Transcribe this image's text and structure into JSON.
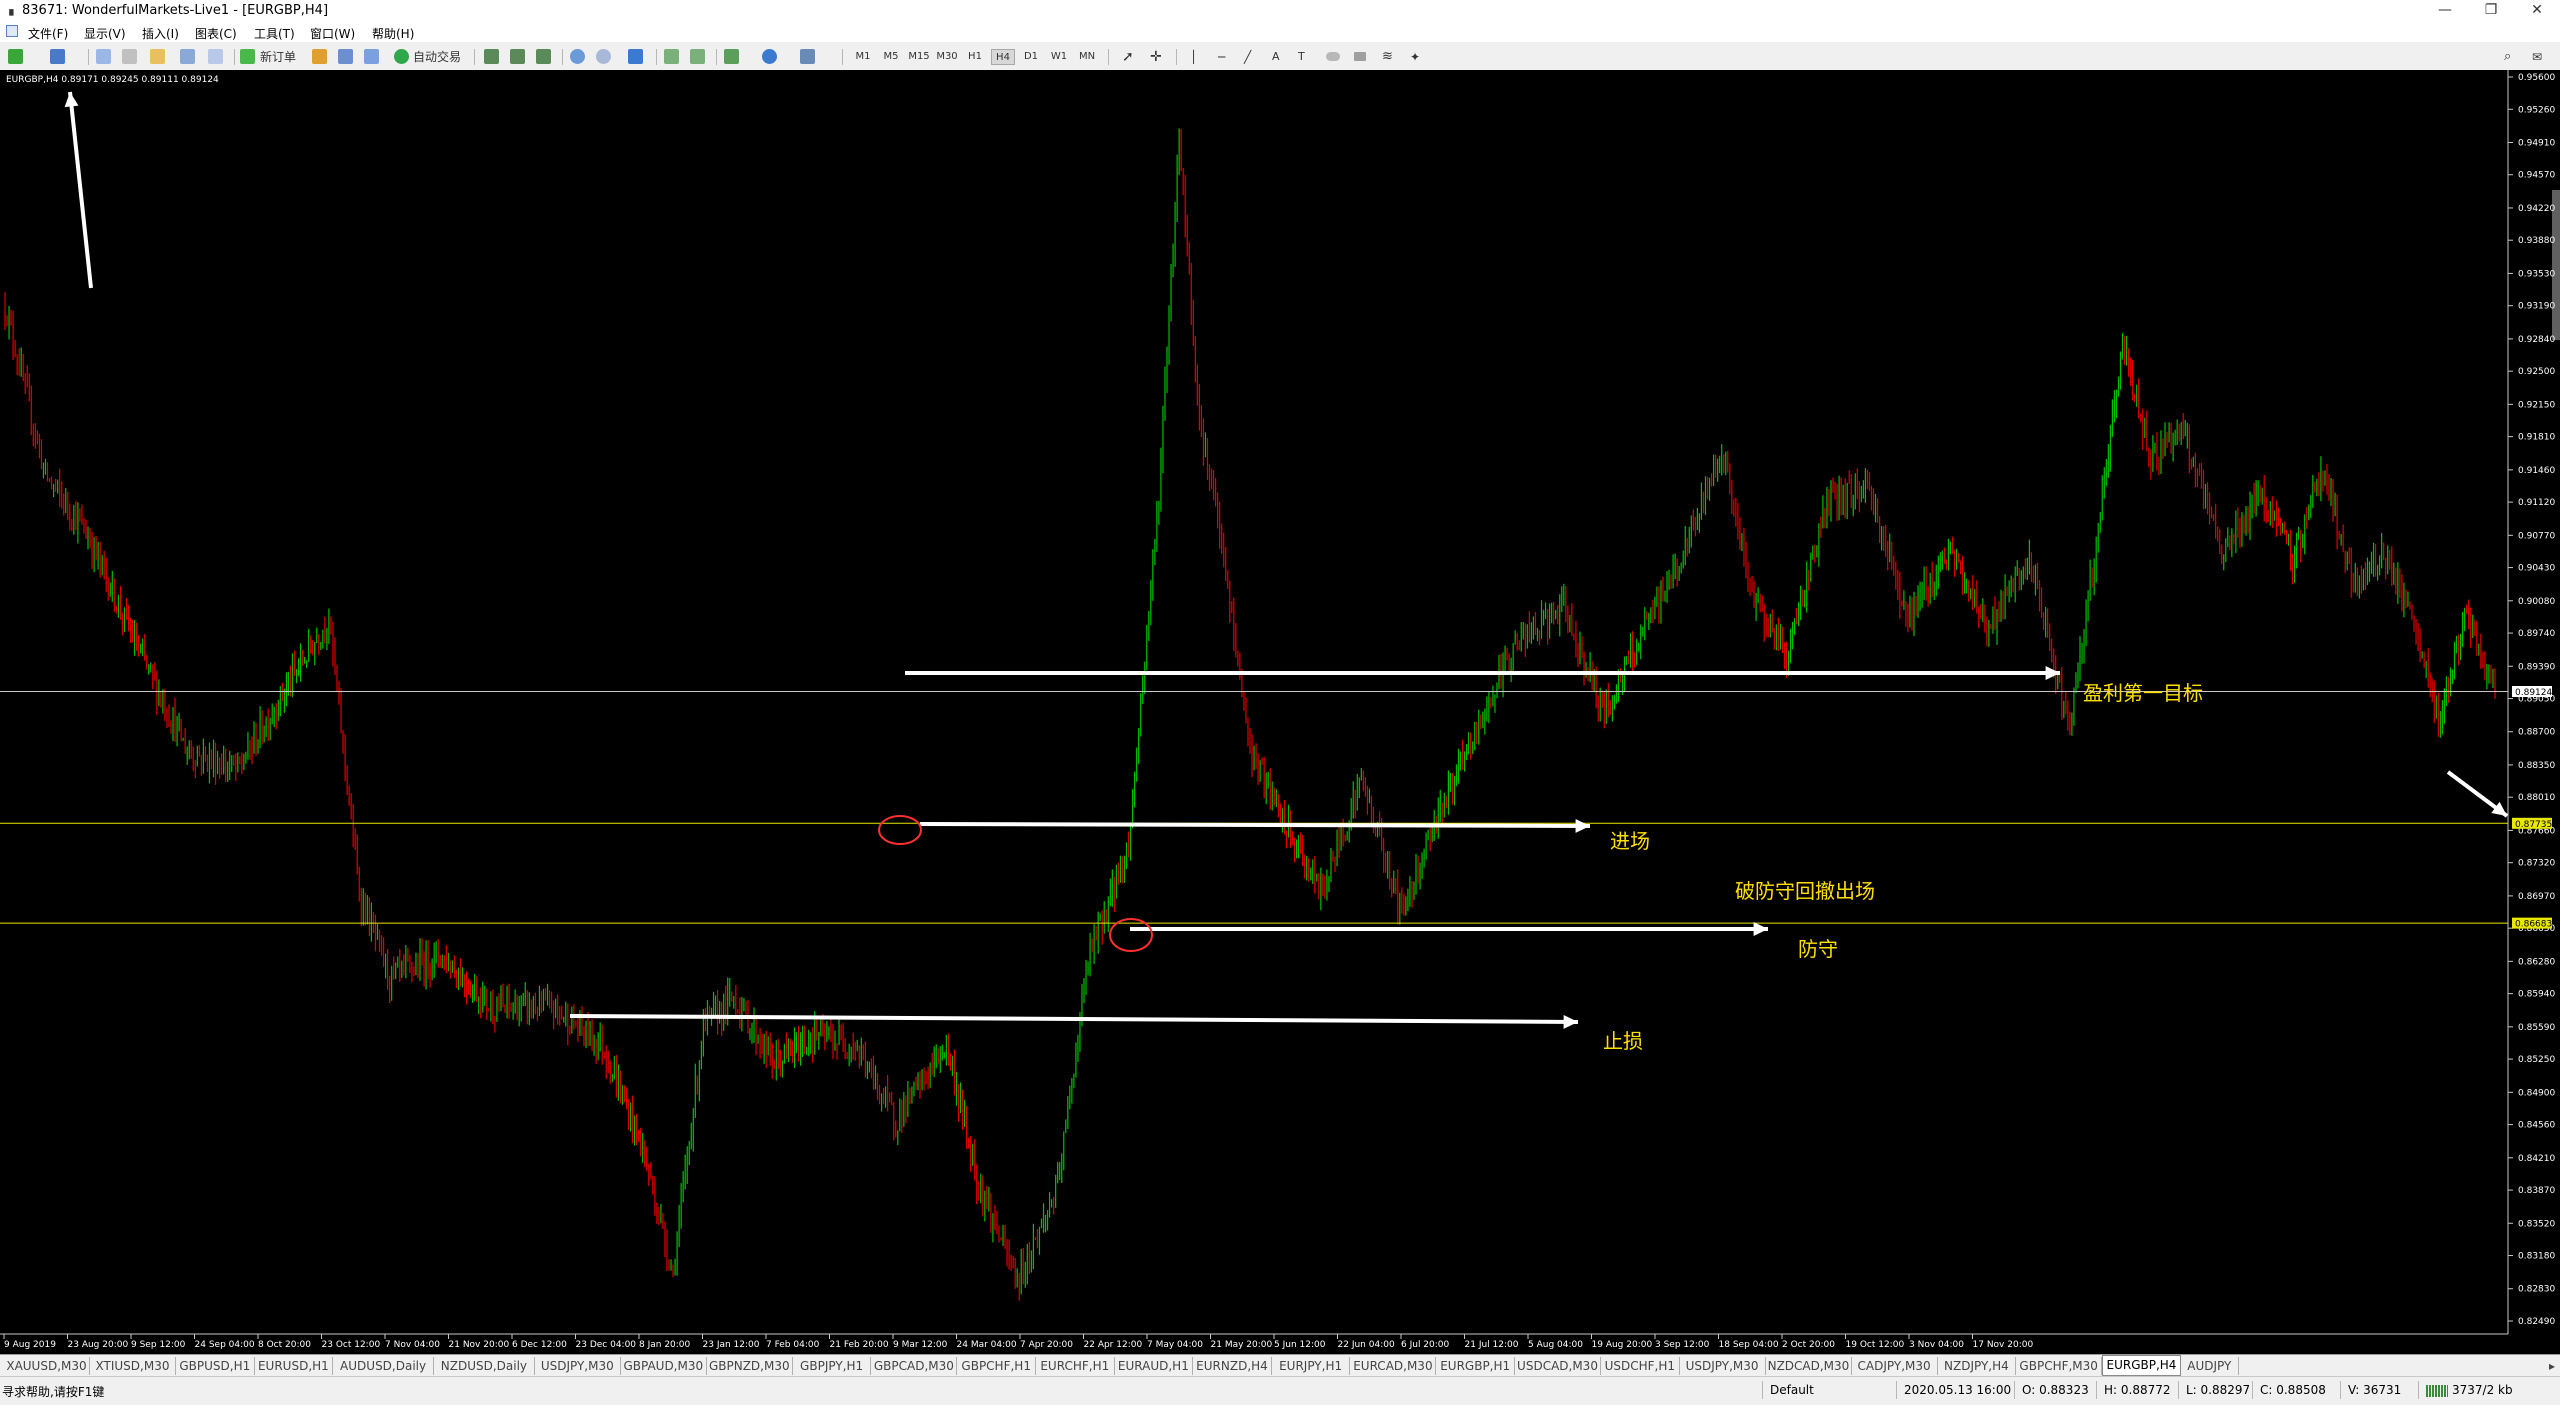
{
  "window": {
    "title": "83671: WonderfulMarkets-Live1 - [EURGBP,H4]",
    "buttons": {
      "minimize": "—",
      "restore": "❐",
      "close": "✕"
    }
  },
  "menu": [
    "文件(F)",
    "显示(V)",
    "插入(I)",
    "图表(C)",
    "工具(T)",
    "窗口(W)",
    "帮助(H)"
  ],
  "toolbar": {
    "new_order": "新订单",
    "auto_trading": "自动交易",
    "timeframes": [
      "M1",
      "M5",
      "M15",
      "M30",
      "H1",
      "H4",
      "D1",
      "W1",
      "MN"
    ],
    "active_timeframe": "H4"
  },
  "chart": {
    "header": "EURGBP,H4  0.89171 0.89245 0.89111 0.89124",
    "colors": {
      "background": "#000000",
      "bull": "#00c000",
      "bear": "#e00000",
      "level_line": "#e8e800",
      "bid_line": "#c8c8c8",
      "annotation_text": "#ffe000",
      "marker": "#ff3030"
    },
    "price_axis": {
      "min": 0.8249,
      "max": 0.956,
      "ticks": [
        "0.95600",
        "0.95260",
        "0.94910",
        "0.94570",
        "0.94220",
        "0.93880",
        "0.93530",
        "0.93190",
        "0.92840",
        "0.92500",
        "0.92150",
        "0.91810",
        "0.91460",
        "0.91120",
        "0.90770",
        "0.90430",
        "0.90080",
        "0.89740",
        "0.89390",
        "0.89050",
        "0.88700",
        "0.88350",
        "0.88010",
        "0.87660",
        "0.87320",
        "0.86970",
        "0.86630",
        "0.86280",
        "0.85940",
        "0.85590",
        "0.85250",
        "0.84900",
        "0.84560",
        "0.84210",
        "0.83870",
        "0.83520",
        "0.83180",
        "0.82830",
        "0.82490"
      ]
    },
    "time_axis": [
      "9 Aug 2019",
      "23 Aug 20:00",
      "9 Sep 12:00",
      "24 Sep 04:00",
      "8 Oct 20:00",
      "23 Oct 12:00",
      "7 Nov 04:00",
      "21 Nov 20:00",
      "6 Dec 12:00",
      "23 Dec 04:00",
      "8 Jan 20:00",
      "23 Jan 12:00",
      "7 Feb 04:00",
      "21 Feb 20:00",
      "9 Mar 12:00",
      "24 Mar 04:00",
      "7 Apr 20:00",
      "22 Apr 12:00",
      "7 May 04:00",
      "21 May 20:00",
      "5 Jun 12:00",
      "22 Jun 04:00",
      "6 Jul 20:00",
      "21 Jul 12:00",
      "5 Aug 04:00",
      "19 Aug 20:00",
      "3 Sep 12:00",
      "18 Sep 04:00",
      "2 Oct 20:00",
      "19 Oct 12:00",
      "3 Nov 04:00",
      "17 Nov 20:00"
    ],
    "levels": [
      {
        "name": "entry-level",
        "price": 0.87735,
        "label": "0.87735"
      },
      {
        "name": "defense-level",
        "price": 0.86683,
        "label": "0.86683"
      }
    ],
    "bid": {
      "price": 0.89124,
      "label": "0.89124"
    },
    "annotations": {
      "target": "盈利第一目标",
      "entry": "进场",
      "exit_note": "破防守回撤出场",
      "defense": "防守",
      "stop": "止损"
    },
    "key_points": [
      {
        "t": 0,
        "p": 0.932
      },
      {
        "t": 20,
        "p": 0.914
      },
      {
        "t": 40,
        "p": 0.908
      },
      {
        "t": 65,
        "p": 0.896
      },
      {
        "t": 90,
        "p": 0.885
      },
      {
        "t": 115,
        "p": 0.883
      },
      {
        "t": 140,
        "p": 0.892
      },
      {
        "t": 160,
        "p": 0.899
      },
      {
        "t": 175,
        "p": 0.87
      },
      {
        "t": 190,
        "p": 0.861
      },
      {
        "t": 215,
        "p": 0.8635
      },
      {
        "t": 240,
        "p": 0.858
      },
      {
        "t": 270,
        "p": 0.858
      },
      {
        "t": 295,
        "p": 0.854
      },
      {
        "t": 315,
        "p": 0.843
      },
      {
        "t": 330,
        "p": 0.83
      },
      {
        "t": 345,
        "p": 0.856
      },
      {
        "t": 360,
        "p": 0.859
      },
      {
        "t": 380,
        "p": 0.852
      },
      {
        "t": 400,
        "p": 0.855
      },
      {
        "t": 420,
        "p": 0.854
      },
      {
        "t": 440,
        "p": 0.846
      },
      {
        "t": 465,
        "p": 0.854
      },
      {
        "t": 480,
        "p": 0.84
      },
      {
        "t": 500,
        "p": 0.829
      },
      {
        "t": 520,
        "p": 0.839
      },
      {
        "t": 535,
        "p": 0.863
      },
      {
        "t": 555,
        "p": 0.875
      },
      {
        "t": 570,
        "p": 0.912
      },
      {
        "t": 580,
        "p": 0.95
      },
      {
        "t": 590,
        "p": 0.92
      },
      {
        "t": 600,
        "p": 0.908
      },
      {
        "t": 615,
        "p": 0.885
      },
      {
        "t": 630,
        "p": 0.878
      },
      {
        "t": 650,
        "p": 0.87
      },
      {
        "t": 670,
        "p": 0.882
      },
      {
        "t": 690,
        "p": 0.868
      },
      {
        "t": 705,
        "p": 0.877
      },
      {
        "t": 725,
        "p": 0.886
      },
      {
        "t": 745,
        "p": 0.896
      },
      {
        "t": 770,
        "p": 0.9
      },
      {
        "t": 790,
        "p": 0.889
      },
      {
        "t": 815,
        "p": 0.9
      },
      {
        "t": 830,
        "p": 0.906
      },
      {
        "t": 848,
        "p": 0.917
      },
      {
        "t": 862,
        "p": 0.902
      },
      {
        "t": 880,
        "p": 0.895
      },
      {
        "t": 900,
        "p": 0.911
      },
      {
        "t": 920,
        "p": 0.913
      },
      {
        "t": 940,
        "p": 0.899
      },
      {
        "t": 960,
        "p": 0.906
      },
      {
        "t": 980,
        "p": 0.898
      },
      {
        "t": 1000,
        "p": 0.905
      },
      {
        "t": 1020,
        "p": 0.887
      },
      {
        "t": 1035,
        "p": 0.91
      },
      {
        "t": 1046,
        "p": 0.928
      },
      {
        "t": 1060,
        "p": 0.916
      },
      {
        "t": 1075,
        "p": 0.919
      },
      {
        "t": 1095,
        "p": 0.906
      },
      {
        "t": 1115,
        "p": 0.912
      },
      {
        "t": 1130,
        "p": 0.905
      },
      {
        "t": 1145,
        "p": 0.915
      },
      {
        "t": 1160,
        "p": 0.902
      },
      {
        "t": 1175,
        "p": 0.906
      },
      {
        "t": 1190,
        "p": 0.898
      },
      {
        "t": 1202,
        "p": 0.888
      },
      {
        "t": 1215,
        "p": 0.899
      },
      {
        "t": 1230,
        "p": 0.8912
      }
    ]
  },
  "tabs": [
    "XAUUSD,M30",
    "XTIUSD,M30",
    "GBPUSD,H1",
    "EURUSD,H1",
    "AUDUSD,Daily",
    "NZDUSD,Daily",
    "USDJPY,M30",
    "GBPAUD,M30",
    "GBPNZD,M30",
    "GBPJPY,H1",
    "GBPCAD,M30",
    "GBPCHF,H1",
    "EURCHF,H1",
    "EURAUD,H1",
    "EURNZD,H4",
    "EURJPY,H1",
    "EURCAD,M30",
    "EURGBP,H1",
    "USDCAD,M30",
    "USDCHF,H1",
    "USDJPY,M30",
    "NZDCAD,M30",
    "CADJPY,M30",
    "NZDJPY,H4",
    "GBPCHF,M30",
    "EURGBP,H4",
    "AUDJPY"
  ],
  "active_tab": "EURGBP,H4",
  "status": {
    "help": "寻求帮助,请按F1键",
    "profile": "Default",
    "datetime": "2020.05.13 16:00",
    "open": "O: 0.88323",
    "high": "H: 0.88772",
    "low": "L: 0.88297",
    "close": "C: 0.88508",
    "volume": "V: 36731",
    "traffic": "3737/2 kb"
  }
}
